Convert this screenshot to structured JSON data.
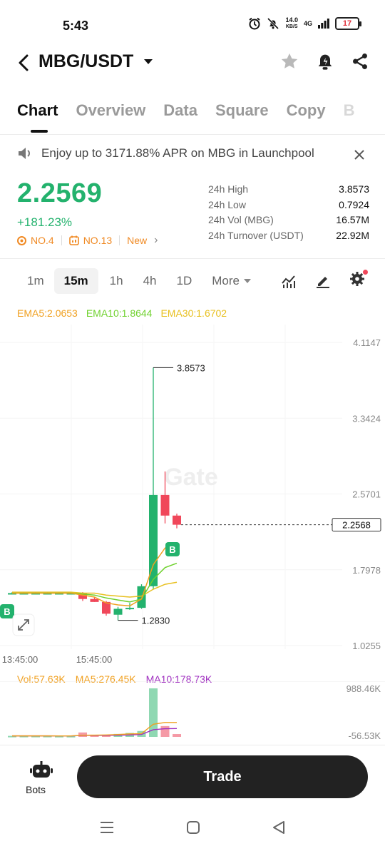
{
  "status_bar": {
    "time": "5:43",
    "net_speed_value": "14.0",
    "net_speed_unit": "KB/S",
    "network": "4G",
    "battery": "17"
  },
  "header": {
    "pair": "MBG/USDT"
  },
  "tabs": [
    {
      "label": "Chart",
      "active": true
    },
    {
      "label": "Overview",
      "active": false
    },
    {
      "label": "Data",
      "active": false
    },
    {
      "label": "Square",
      "active": false
    },
    {
      "label": "Copy",
      "active": false
    },
    {
      "label": "B",
      "active": false
    }
  ],
  "banner": {
    "text": "Enjoy up to 3171.88% APR on MBG in Launchpool"
  },
  "ticker": {
    "price": "2.2569",
    "change": "+181.23%",
    "rank1": "NO.4",
    "rank2": "NO.13",
    "tag": "New",
    "stats": [
      {
        "label": "24h High",
        "value": "3.8573"
      },
      {
        "label": "24h Low",
        "value": "0.7924"
      },
      {
        "label": "24h Vol (MBG)",
        "value": "16.57M"
      },
      {
        "label": "24h Turnover (USDT)",
        "value": "22.92M"
      }
    ]
  },
  "timeframes": {
    "items": [
      "1m",
      "15m",
      "1h",
      "4h",
      "1D"
    ],
    "active": "15m",
    "more_label": "More"
  },
  "indicators": {
    "ema5": "EMA5:2.0653",
    "ema10": "EMA10:1.8644",
    "ema30": "EMA30:1.6702",
    "vol": "Vol:57.63K",
    "ma5": "MA5:276.45K",
    "ma10": "MA10:178.73K"
  },
  "colors": {
    "up": "#23b26d",
    "down": "#f0475a",
    "ema5": "#f0a020",
    "ema10": "#6fd12e",
    "ema30": "#e8c020",
    "ma10": "#a030c0"
  },
  "chart_data": {
    "type": "candlestick",
    "watermark": "Gate",
    "y_ticks": [
      "4.1147",
      "3.3424",
      "2.5701",
      "1.7978",
      "1.0255"
    ],
    "x_ticks": [
      "13:45:00",
      "15:45:00"
    ],
    "ylim": [
      1.0255,
      4.1147
    ],
    "high_label": "3.8573",
    "low_label": "1.2830",
    "current_price_label": "2.2568",
    "candles": [
      {
        "o": 1.56,
        "h": 1.57,
        "l": 1.55,
        "c": 1.56
      },
      {
        "o": 1.56,
        "h": 1.57,
        "l": 1.55,
        "c": 1.56
      },
      {
        "o": 1.56,
        "h": 1.57,
        "l": 1.55,
        "c": 1.56
      },
      {
        "o": 1.56,
        "h": 1.57,
        "l": 1.55,
        "c": 1.56
      },
      {
        "o": 1.56,
        "h": 1.57,
        "l": 1.55,
        "c": 1.56
      },
      {
        "o": 1.56,
        "h": 1.57,
        "l": 1.55,
        "c": 1.56
      },
      {
        "o": 1.56,
        "h": 1.57,
        "l": 1.48,
        "c": 1.5
      },
      {
        "o": 1.5,
        "h": 1.52,
        "l": 1.47,
        "c": 1.47
      },
      {
        "o": 1.47,
        "h": 1.48,
        "l": 1.33,
        "c": 1.35
      },
      {
        "o": 1.34,
        "h": 1.42,
        "l": 1.283,
        "c": 1.4
      },
      {
        "o": 1.4,
        "h": 1.46,
        "l": 1.39,
        "c": 1.41
      },
      {
        "o": 1.41,
        "h": 1.65,
        "l": 1.4,
        "c": 1.63
      },
      {
        "o": 1.63,
        "h": 3.8573,
        "l": 1.6,
        "c": 2.56
      },
      {
        "o": 2.56,
        "h": 2.8,
        "l": 2.27,
        "c": 2.35
      },
      {
        "o": 2.35,
        "h": 2.37,
        "l": 2.22,
        "c": 2.2568
      }
    ],
    "ema5": [
      1.56,
      1.56,
      1.56,
      1.56,
      1.56,
      1.56,
      1.54,
      1.52,
      1.46,
      1.44,
      1.43,
      1.5,
      1.85,
      2.02,
      2.0653
    ],
    "ema10": [
      1.56,
      1.56,
      1.56,
      1.56,
      1.56,
      1.56,
      1.55,
      1.54,
      1.51,
      1.49,
      1.47,
      1.5,
      1.7,
      1.82,
      1.8644
    ],
    "ema30": [
      1.57,
      1.57,
      1.57,
      1.57,
      1.57,
      1.57,
      1.56,
      1.56,
      1.54,
      1.53,
      1.52,
      1.53,
      1.6,
      1.65,
      1.6702
    ],
    "volume_ticks": [
      "988.46K",
      "-56.53K"
    ],
    "volumes": [
      20,
      20,
      20,
      20,
      18,
      18,
      90,
      30,
      40,
      60,
      80,
      120,
      988.46,
      220,
      57.63
    ]
  }
}
